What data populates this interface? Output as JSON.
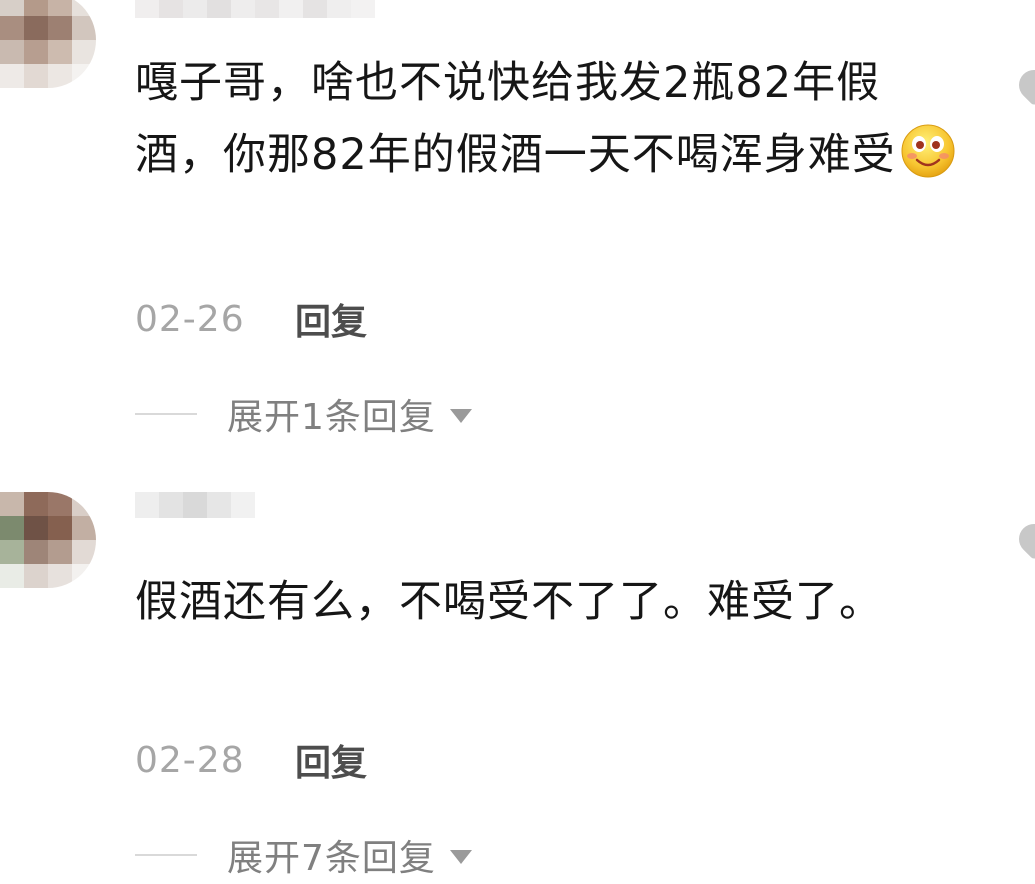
{
  "comments": [
    {
      "text_before_emoji": "嘎子哥，啥也不说快给我发2瓶82年假酒，你那82年的假酒一天不喝浑身难受",
      "emoji": "smiling-face-emoji",
      "date": "02-26",
      "reply_label": "回复",
      "expand_label": "展开1条回复"
    },
    {
      "text_before_emoji": "假酒还有么，不喝受不了了。难受了。",
      "date": "02-28",
      "reply_label": "回复",
      "expand_label": "展开7条回复"
    }
  ],
  "icons": {
    "avatar": "pixelated-avatar",
    "like": "heart-icon",
    "expand_arrow": "caret-down-icon"
  },
  "colors": {
    "text": "#161616",
    "meta": "#a6a6a6",
    "reply": "#4d4d4d",
    "expand": "#808080",
    "background": "#ffffff"
  }
}
